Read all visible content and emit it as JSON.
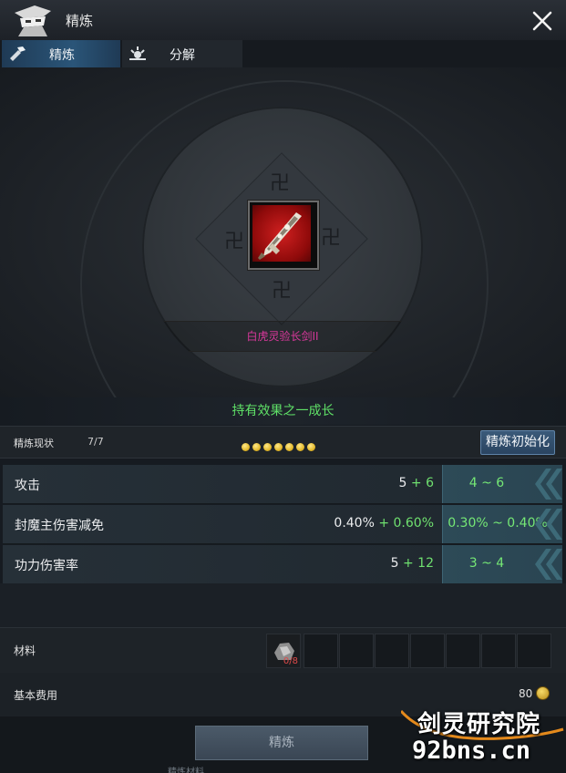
{
  "window": {
    "title": "精炼"
  },
  "tabs": [
    {
      "label": "精炼",
      "icon": "hammer-icon",
      "active": true
    },
    {
      "label": "分解",
      "icon": "decompose-icon",
      "active": false
    }
  ],
  "item": {
    "name": "白虎灵验长剑II",
    "name_color": "#d9389c",
    "icon": "sword-icon"
  },
  "effect_text": "持有效果之一成长",
  "status": {
    "label": "精炼现状",
    "count": "7/7",
    "dots": 7,
    "reset_label": "精炼初始化"
  },
  "stats": [
    {
      "name": "攻击",
      "base": "5",
      "bonus": "+ 6",
      "range": "4 ~ 6"
    },
    {
      "name": "封魔主伤害减免",
      "base": "0.40%",
      "bonus": "+ 0.60%",
      "range": "0.30% ~ 0.40%"
    },
    {
      "name": "功力伤害率",
      "base": "5",
      "bonus": "+ 12",
      "range": "3 ~ 4"
    }
  ],
  "materials": {
    "label": "材料",
    "first_count": "0/8",
    "slot_count": 8
  },
  "cost": {
    "label": "基本费用",
    "value": "80",
    "icon": "coin-icon"
  },
  "footer": {
    "button_label": "精炼",
    "truncated_text": "精炼材料"
  },
  "watermark": {
    "title": "剑灵研究院",
    "url": "92bns.cn"
  },
  "colors": {
    "accent": "#2a5578",
    "bonus_green": "#6fe06f",
    "effect_green": "#5fe067",
    "item_pink": "#d9389c"
  }
}
